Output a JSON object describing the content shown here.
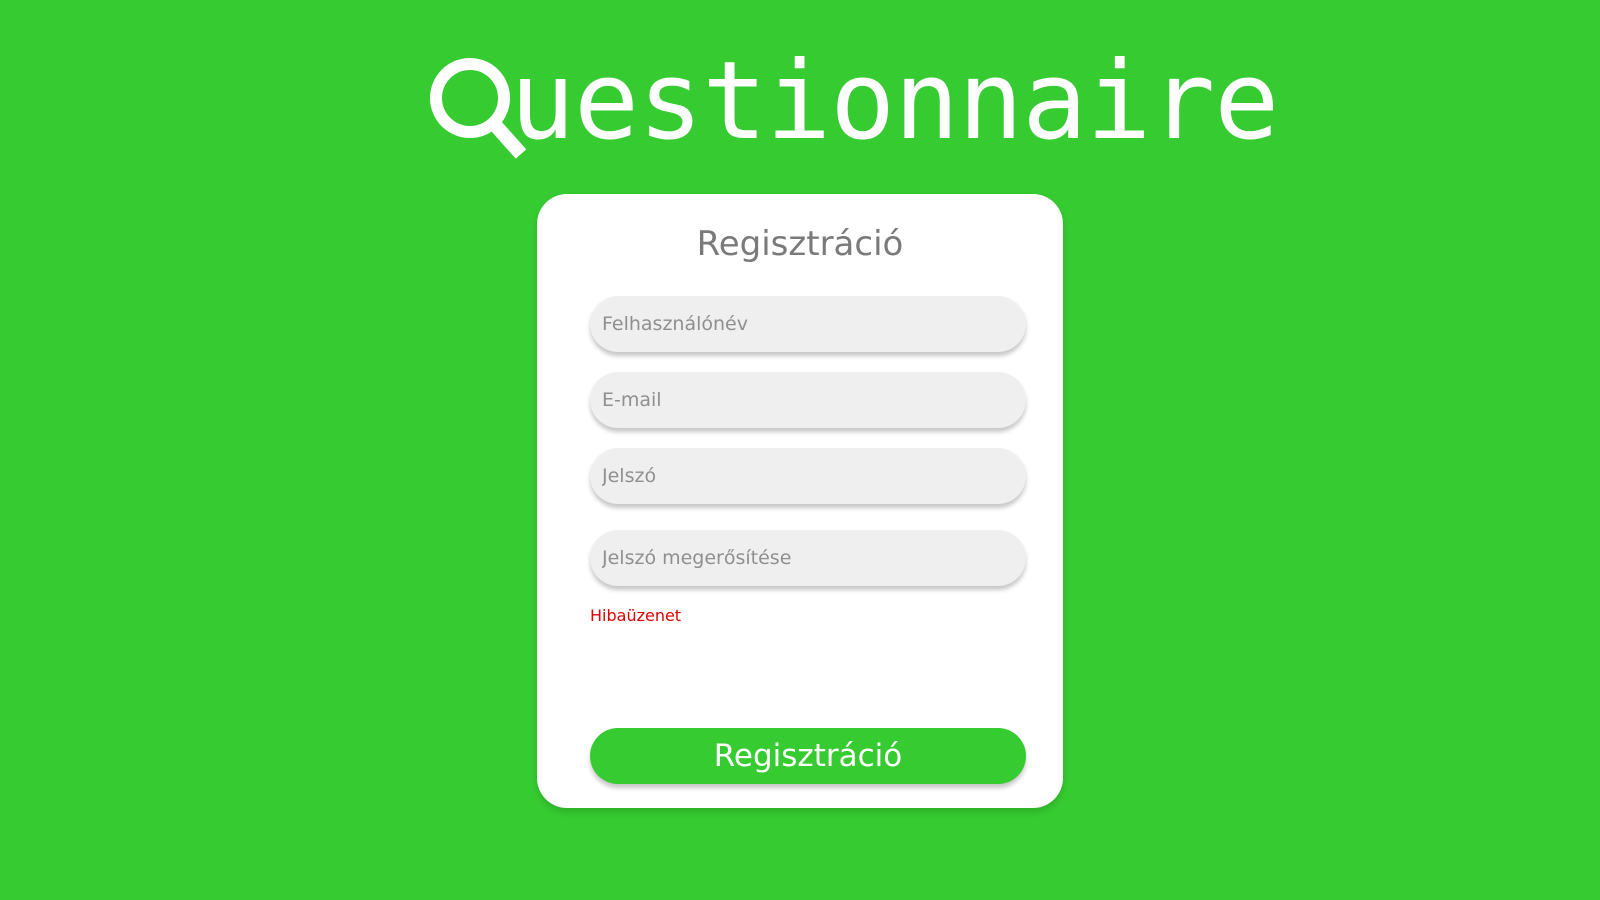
{
  "colors": {
    "background": "#36cc31",
    "card": "#ffffff",
    "field": "#efefef",
    "error": "#e00000",
    "button": "#36cc31"
  },
  "logo": {
    "icon": "magnifier-icon",
    "text": "uestionnaire"
  },
  "form": {
    "title": "Regisztráció",
    "fields": {
      "username": {
        "placeholder": "Felhasználónév",
        "value": ""
      },
      "email": {
        "placeholder": "E-mail",
        "value": ""
      },
      "password": {
        "placeholder": "Jelszó",
        "value": ""
      },
      "password_confirm": {
        "placeholder": "Jelszó megerősítése",
        "value": ""
      }
    },
    "error_message": "Hibaüzenet",
    "submit_label": "Regisztráció"
  }
}
